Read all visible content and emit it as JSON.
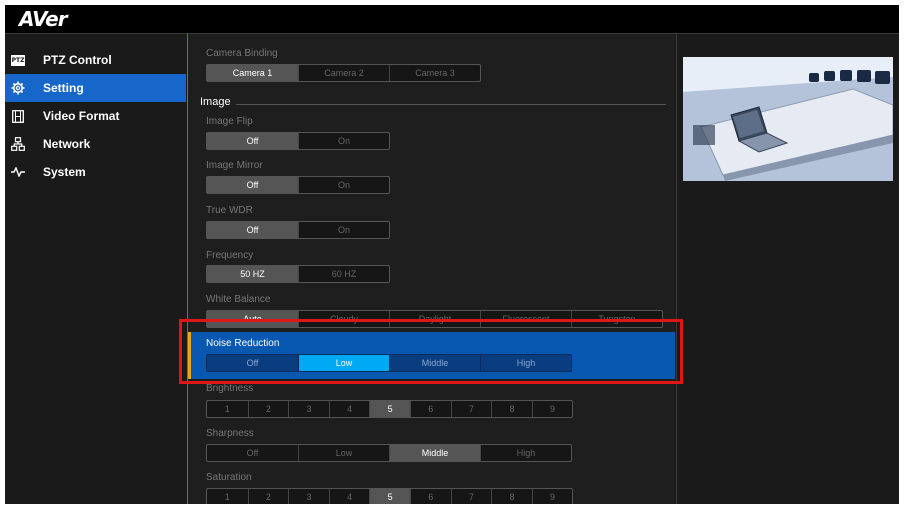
{
  "app": {
    "logo": "AVer"
  },
  "sidebar": {
    "items": [
      {
        "label": "PTZ Control",
        "icon": "ptz-icon",
        "active": false
      },
      {
        "label": "Setting",
        "icon": "gear-icon",
        "active": true
      },
      {
        "label": "Video Format",
        "icon": "film-icon",
        "active": false
      },
      {
        "label": "Network",
        "icon": "network-icon",
        "active": false
      },
      {
        "label": "System",
        "icon": "pulse-icon",
        "active": false
      }
    ]
  },
  "main": {
    "camera_binding": {
      "label": "Camera Binding",
      "options": [
        "Camera 1",
        "Camera 2",
        "Camera 3"
      ],
      "selected": "Camera 1"
    },
    "image_section": "Image",
    "image_flip": {
      "label": "Image Flip",
      "options": [
        "Off",
        "On"
      ],
      "selected": "Off"
    },
    "image_mirror": {
      "label": "Image Mirror",
      "options": [
        "Off",
        "On"
      ],
      "selected": "Off"
    },
    "true_wdr": {
      "label": "True WDR",
      "options": [
        "Off",
        "On"
      ],
      "selected": "Off"
    },
    "frequency": {
      "label": "Frequency",
      "options": [
        "50 HZ",
        "60 HZ"
      ],
      "selected": "50 HZ"
    },
    "white_balance": {
      "label": "White Balance",
      "options": [
        "Auto",
        "Cloudy",
        "Daylight",
        "Fluorescent",
        "Tungsten"
      ],
      "selected": "Auto"
    },
    "noise_reduction": {
      "label": "Noise Reduction",
      "options": [
        "Off",
        "Low",
        "Middle",
        "High"
      ],
      "selected": "Low"
    },
    "brightness": {
      "label": "Brightness",
      "options": [
        "1",
        "2",
        "3",
        "4",
        "5",
        "6",
        "7",
        "8",
        "9"
      ],
      "selected": "5"
    },
    "sharpness": {
      "label": "Sharpness",
      "options": [
        "Off",
        "Low",
        "Middle",
        "High"
      ],
      "selected": "Middle"
    },
    "saturation": {
      "label": "Saturation",
      "options": [
        "1",
        "2",
        "3",
        "4",
        "5",
        "6",
        "7",
        "8",
        "9"
      ],
      "selected": "5"
    }
  },
  "colors": {
    "accent": "#1766c9",
    "selected_blue": "#00a9f4",
    "highlight_row": "#0857b1",
    "annotation_red": "#e01515"
  }
}
